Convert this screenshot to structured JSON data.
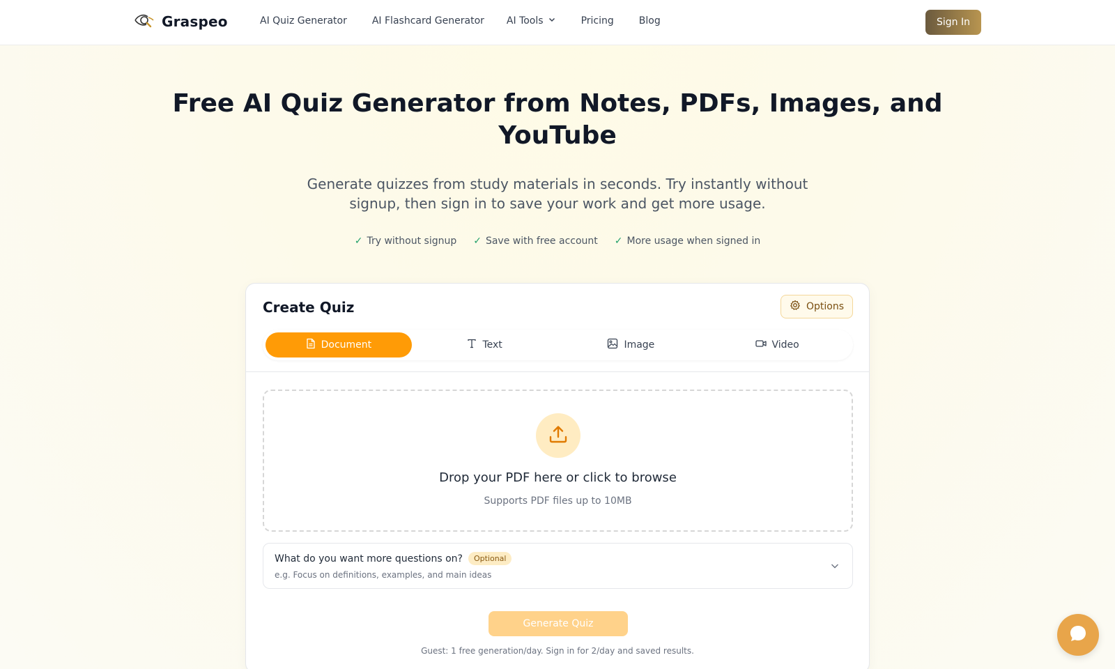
{
  "header": {
    "logo_text": "Graspeo",
    "logo_icon": "eye-magnifier-icon",
    "nav": [
      {
        "label": "AI Quiz Generator"
      },
      {
        "label": "AI Flashcard Generator"
      },
      {
        "label": "AI Tools",
        "has_dropdown": true
      },
      {
        "label": "Pricing"
      },
      {
        "label": "Blog"
      }
    ],
    "signin_label": "Sign In"
  },
  "hero": {
    "title": "Free AI Quiz Generator from Notes, PDFs, Images, and YouTube",
    "subtitle": "Generate quizzes from study materials in seconds. Try instantly without signup, then sign in to save your work and get more usage.",
    "checks": [
      {
        "mark": "✓",
        "label": "Try without signup"
      },
      {
        "mark": "✓",
        "label": "Save with free account"
      },
      {
        "mark": "✓",
        "label": "More usage when signed in"
      }
    ]
  },
  "card": {
    "title": "Create Quiz",
    "options_label": "Options",
    "tabs": [
      {
        "label": "Document",
        "icon": "document-icon",
        "active": true
      },
      {
        "label": "Text",
        "icon": "text-icon",
        "active": false
      },
      {
        "label": "Image",
        "icon": "image-icon",
        "active": false
      },
      {
        "label": "Video",
        "icon": "video-icon",
        "active": false
      }
    ],
    "dropzone": {
      "title": "Drop your PDF here or click to browse",
      "subtitle": "Supports PDF files up to 10MB"
    },
    "focus": {
      "label": "What do you want more questions on?",
      "badge": "Optional",
      "hint": "e.g. Focus on definitions, examples, and main ideas"
    },
    "generate_label": "Generate Quiz",
    "guest_note": "Guest: 1 free generation/day. Sign in for 2/day and saved results."
  },
  "colors": {
    "accent": "#ff9b06",
    "accent_light": "#ffd28a",
    "signin_gradient_start": "#6b5a3e",
    "signin_gradient_end": "#b89550",
    "check_green": "#22a06b",
    "chat_button": "#e8a54a"
  }
}
